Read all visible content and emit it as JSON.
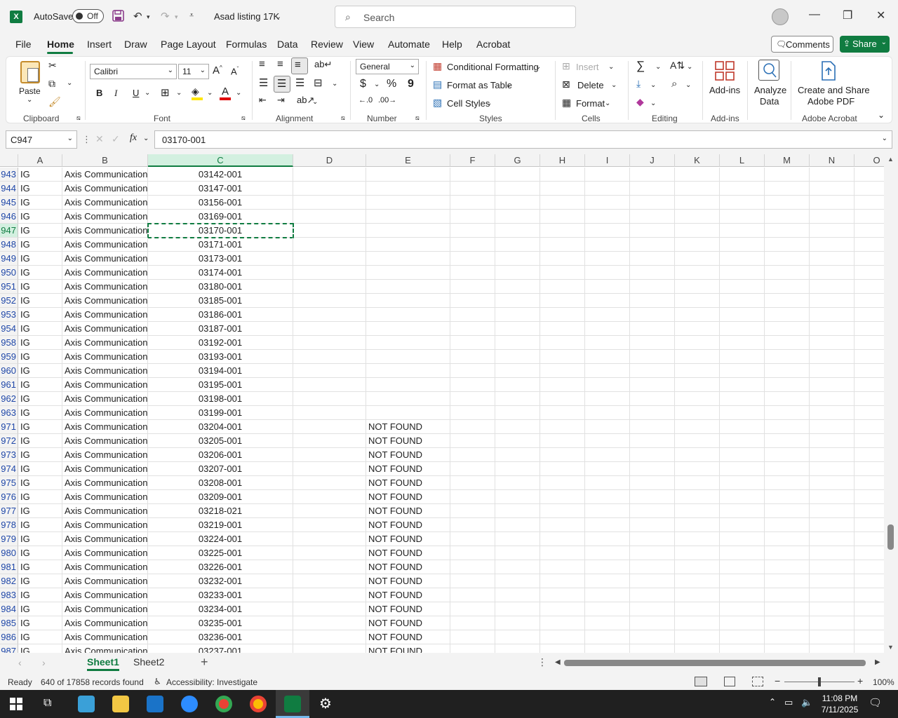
{
  "titlebar": {
    "autosave_label": "AutoSave",
    "toggle_state": "Off",
    "doc_title": "Asad listing 17K",
    "search_placeholder": "Search"
  },
  "menu": {
    "tabs": [
      "File",
      "Home",
      "Insert",
      "Draw",
      "Page Layout",
      "Formulas",
      "Data",
      "Review",
      "View",
      "Automate",
      "Help",
      "Acrobat"
    ],
    "active": "Home",
    "comments": "Comments",
    "share": "Share"
  },
  "ribbon": {
    "groups": {
      "clipboard": "Clipboard",
      "font": "Font",
      "alignment": "Alignment",
      "number": "Number",
      "styles": "Styles",
      "cells": "Cells",
      "editing": "Editing",
      "addins": "Add-ins",
      "acrobat": "Adobe Acrobat"
    },
    "paste": "Paste",
    "font_name": "Calibri",
    "font_size": "11",
    "bold": "B",
    "italic": "I",
    "underline": "U",
    "number_format": "General",
    "currency": "$",
    "percent": "%",
    "comma": "9",
    "conditional_formatting": "Conditional Formatting",
    "format_as_table": "Format as Table",
    "cell_styles": "Cell Styles",
    "insert": "Insert",
    "delete": "Delete",
    "format": "Format",
    "addins_btn": "Add-ins",
    "analyze_data_1": "Analyze",
    "analyze_data_2": "Data",
    "create_share_1": "Create and Share",
    "create_share_2": "Adobe PDF"
  },
  "formula_bar": {
    "name_box": "C947",
    "fx": "fx",
    "value": "03170-001"
  },
  "columns": [
    "A",
    "B",
    "C",
    "D",
    "E",
    "F",
    "G",
    "H",
    "I",
    "J",
    "K",
    "L",
    "M",
    "N",
    "O"
  ],
  "rows": [
    {
      "num": "943",
      "a": "IG",
      "b": "Axis Communications",
      "c": "03142-001",
      "e": ""
    },
    {
      "num": "944",
      "a": "IG",
      "b": "Axis Communications",
      "c": "03147-001",
      "e": ""
    },
    {
      "num": "945",
      "a": "IG",
      "b": "Axis Communications",
      "c": "03156-001",
      "e": ""
    },
    {
      "num": "946",
      "a": "IG",
      "b": "Axis Communications",
      "c": "03169-001",
      "e": ""
    },
    {
      "num": "947",
      "a": "IG",
      "b": "Axis Communications",
      "c": "03170-001",
      "e": ""
    },
    {
      "num": "948",
      "a": "IG",
      "b": "Axis Communications",
      "c": "03171-001",
      "e": ""
    },
    {
      "num": "949",
      "a": "IG",
      "b": "Axis Communications",
      "c": "03173-001",
      "e": ""
    },
    {
      "num": "950",
      "a": "IG",
      "b": "Axis Communications",
      "c": "03174-001",
      "e": ""
    },
    {
      "num": "951",
      "a": "IG",
      "b": "Axis Communications",
      "c": "03180-001",
      "e": ""
    },
    {
      "num": "952",
      "a": "IG",
      "b": "Axis Communications",
      "c": "03185-001",
      "e": ""
    },
    {
      "num": "953",
      "a": "IG",
      "b": "Axis Communications",
      "c": "03186-001",
      "e": ""
    },
    {
      "num": "954",
      "a": "IG",
      "b": "Axis Communications",
      "c": "03187-001",
      "e": ""
    },
    {
      "num": "958",
      "a": "IG",
      "b": "Axis Communications",
      "c": "03192-001",
      "e": ""
    },
    {
      "num": "959",
      "a": "IG",
      "b": "Axis Communications",
      "c": "03193-001",
      "e": ""
    },
    {
      "num": "960",
      "a": "IG",
      "b": "Axis Communications",
      "c": "03194-001",
      "e": ""
    },
    {
      "num": "961",
      "a": "IG",
      "b": "Axis Communications",
      "c": "03195-001",
      "e": ""
    },
    {
      "num": "962",
      "a": "IG",
      "b": "Axis Communications",
      "c": "03198-001",
      "e": ""
    },
    {
      "num": "963",
      "a": "IG",
      "b": "Axis Communications",
      "c": "03199-001",
      "e": ""
    },
    {
      "num": "971",
      "a": "IG",
      "b": "Axis Communications",
      "c": "03204-001",
      "e": "NOT FOUND"
    },
    {
      "num": "972",
      "a": "IG",
      "b": "Axis Communications",
      "c": "03205-001",
      "e": "NOT FOUND"
    },
    {
      "num": "973",
      "a": "IG",
      "b": "Axis Communications",
      "c": "03206-001",
      "e": "NOT FOUND"
    },
    {
      "num": "974",
      "a": "IG",
      "b": "Axis Communications",
      "c": "03207-001",
      "e": "NOT FOUND"
    },
    {
      "num": "975",
      "a": "IG",
      "b": "Axis Communications",
      "c": "03208-001",
      "e": "NOT FOUND"
    },
    {
      "num": "976",
      "a": "IG",
      "b": "Axis Communications",
      "c": "03209-001",
      "e": "NOT FOUND"
    },
    {
      "num": "977",
      "a": "IG",
      "b": "Axis Communications",
      "c": "03218-021",
      "e": "NOT FOUND"
    },
    {
      "num": "978",
      "a": "IG",
      "b": "Axis Communications",
      "c": "03219-001",
      "e": "NOT FOUND"
    },
    {
      "num": "979",
      "a": "IG",
      "b": "Axis Communications",
      "c": "03224-001",
      "e": "NOT FOUND"
    },
    {
      "num": "980",
      "a": "IG",
      "b": "Axis Communications",
      "c": "03225-001",
      "e": "NOT FOUND"
    },
    {
      "num": "981",
      "a": "IG",
      "b": "Axis Communications",
      "c": "03226-001",
      "e": "NOT FOUND"
    },
    {
      "num": "982",
      "a": "IG",
      "b": "Axis Communications",
      "c": "03232-001",
      "e": "NOT FOUND"
    },
    {
      "num": "983",
      "a": "IG",
      "b": "Axis Communications",
      "c": "03233-001",
      "e": "NOT FOUND"
    },
    {
      "num": "984",
      "a": "IG",
      "b": "Axis Communications",
      "c": "03234-001",
      "e": "NOT FOUND"
    },
    {
      "num": "985",
      "a": "IG",
      "b": "Axis Communications",
      "c": "03235-001",
      "e": "NOT FOUND"
    },
    {
      "num": "986",
      "a": "IG",
      "b": "Axis Communications",
      "c": "03236-001",
      "e": "NOT FOUND"
    },
    {
      "num": "987",
      "a": "IG",
      "b": "Axis Communications",
      "c": "03237-001",
      "e": "NOT FOUND"
    }
  ],
  "selected": {
    "row": "947",
    "col": "C"
  },
  "sheets": [
    "Sheet1",
    "Sheet2"
  ],
  "active_sheet": "Sheet1",
  "status": {
    "ready": "Ready",
    "records": "640 of 17858 records found",
    "accessibility": "Accessibility: Investigate",
    "zoom": "100%"
  },
  "taskbar": {
    "time": "11:08 PM",
    "date": "7/11/2025"
  },
  "colors": {
    "excel_green": "#107c41",
    "row_number_blue": "#1f47a8",
    "taskbar": "#202020"
  }
}
